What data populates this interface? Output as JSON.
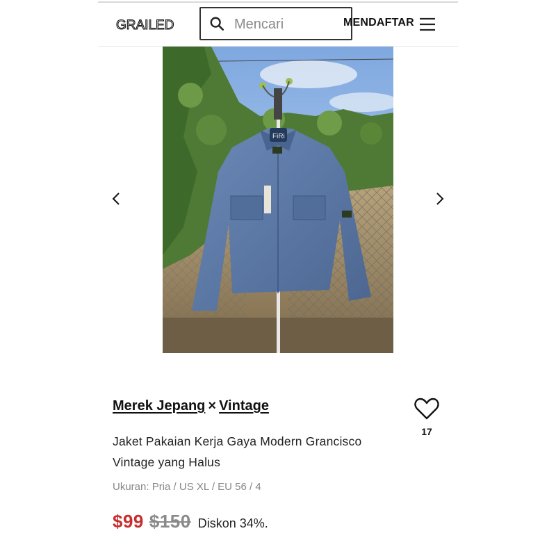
{
  "header": {
    "logo_text": "GRAILED",
    "search_placeholder": "Mencari",
    "signup_label": "MENDAFTAR",
    "menu_icon": "hamburger-menu-icon",
    "search_icon": "search-icon"
  },
  "gallery": {
    "prev_icon": "chevron-left-icon",
    "next_icon": "chevron-right-icon",
    "hanger_tag": "FiRi"
  },
  "listing": {
    "brand_1": "Merek Jepang",
    "separator": "×",
    "brand_2": "Vintage",
    "title": "Jaket Pakaian Kerja Gaya Modern Grancisco Vintage yang Halus",
    "size": "Ukuran: Pria / US XL / EU 56 / 4",
    "price": "$99",
    "original_price": "$150",
    "discount": "Diskon 34%.",
    "favorites_count": "17",
    "favorite_icon": "heart-icon"
  },
  "colors": {
    "price_red": "#c62d2d",
    "jacket_blue": "#5b77a4"
  }
}
